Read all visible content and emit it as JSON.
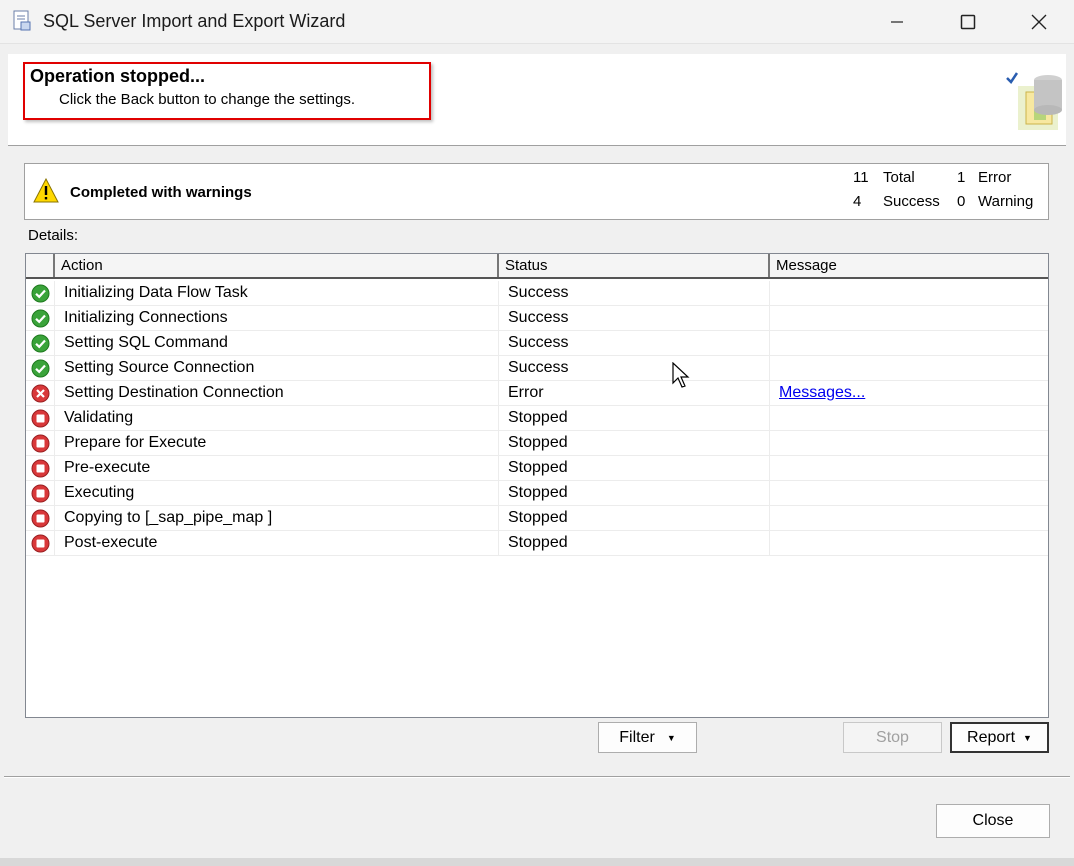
{
  "window": {
    "title": "SQL Server Import and Export Wizard",
    "app_icon": "wizard-document-icon",
    "controls": [
      "minimize-icon",
      "maximize-icon",
      "close-icon"
    ]
  },
  "header": {
    "title": "Operation stopped...",
    "subtitle": "Click the Back button to change the settings.",
    "logo_icon": "wizard-cube-icon",
    "highlight_color": "#e00000"
  },
  "summary": {
    "icon": "warning-icon",
    "text": "Completed with warnings",
    "total_count": "11",
    "total_label": "Total",
    "error_count": "1",
    "error_label": "Error",
    "success_count": "4",
    "success_label": "Success",
    "warning_count": "0",
    "warning_label": "Warning"
  },
  "details_label": "Details:",
  "grid": {
    "columns": [
      "Action",
      "Status",
      "Message"
    ],
    "rows": [
      {
        "icon": "success-icon",
        "action": "Initializing Data Flow Task",
        "status": "Success",
        "message": ""
      },
      {
        "icon": "success-icon",
        "action": "Initializing Connections",
        "status": "Success",
        "message": ""
      },
      {
        "icon": "success-icon",
        "action": "Setting SQL Command",
        "status": "Success",
        "message": ""
      },
      {
        "icon": "success-icon",
        "action": "Setting Source Connection",
        "status": "Success",
        "message": ""
      },
      {
        "icon": "error-icon",
        "action": "Setting Destination Connection",
        "status": "Error",
        "message": "Messages..."
      },
      {
        "icon": "stopped-icon",
        "action": "Validating",
        "status": "Stopped",
        "message": ""
      },
      {
        "icon": "stopped-icon",
        "action": "Prepare for Execute",
        "status": "Stopped",
        "message": ""
      },
      {
        "icon": "stopped-icon",
        "action": "Pre-execute",
        "status": "Stopped",
        "message": ""
      },
      {
        "icon": "stopped-icon",
        "action": "Executing",
        "status": "Stopped",
        "message": ""
      },
      {
        "icon": "stopped-icon",
        "action": "Copying to [_sap_pipe_map ]",
        "status": "Stopped",
        "message": ""
      },
      {
        "icon": "stopped-icon",
        "action": "Post-execute",
        "status": "Stopped",
        "message": ""
      }
    ]
  },
  "buttons": {
    "filter": "Filter",
    "stop": "Stop",
    "report": "Report",
    "close": "Close"
  },
  "colors": {
    "success": "#3aa33a",
    "error": "#d9383a",
    "link": "#0000ee"
  }
}
